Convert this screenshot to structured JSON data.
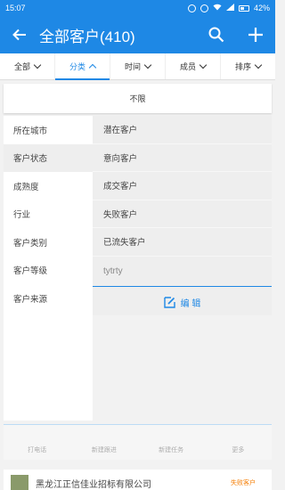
{
  "status": {
    "time": "15:07",
    "battery": "42%"
  },
  "appbar": {
    "title": "全部客户(410)"
  },
  "tabs": [
    {
      "label": "全部"
    },
    {
      "label": "分类"
    },
    {
      "label": "时间"
    },
    {
      "label": "成员"
    },
    {
      "label": "排序"
    }
  ],
  "filter": {
    "unlimited": "不限"
  },
  "categories": [
    "所在城市",
    "客户状态",
    "成熟度",
    "行业",
    "客户类别",
    "客户等级",
    "客户来源"
  ],
  "options": [
    "潜在客户",
    "意向客户",
    "成交客户",
    "失败客户",
    "已流失客户"
  ],
  "custom_input": {
    "value": "tytrty"
  },
  "edit": {
    "label": "编 辑"
  },
  "list_actions": [
    "打电话",
    "新建跟进",
    "新建任务",
    "更多"
  ],
  "list_item": {
    "name": "黑龙江正信佳业招标有限公司",
    "badge": "失败客户"
  }
}
